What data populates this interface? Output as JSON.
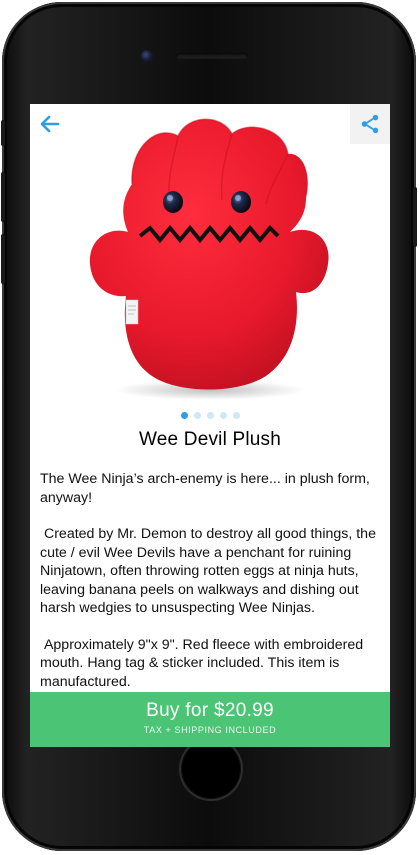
{
  "colors": {
    "accent": "#2f9ee0",
    "buy_button": "#4cc476",
    "product_red": "#e8192c"
  },
  "header": {
    "back_icon": "arrow-left-icon",
    "share_icon": "share-icon"
  },
  "product": {
    "title": "Wee Devil Plush",
    "image_count": 5,
    "active_image": 1,
    "description": [
      "The Wee Ninja’s arch-enemy is here... in plush form, anyway!",
      " Created by Mr. Demon to destroy all good things, the cute / evil Wee Devils have a penchant for ruining Ninjatown, often throwing rotten eggs at ninja huts, leaving banana peels on walkways and dishing out harsh wedgies to unsuspecting Wee Ninjas.",
      " Approximately 9\"x 9\". Red fleece with embroidered mouth. Hang tag & sticker included. This item is manufactured."
    ]
  },
  "buy": {
    "label": "Buy for $20.99",
    "sublabel": "TAX + SHIPPING INCLUDED"
  }
}
